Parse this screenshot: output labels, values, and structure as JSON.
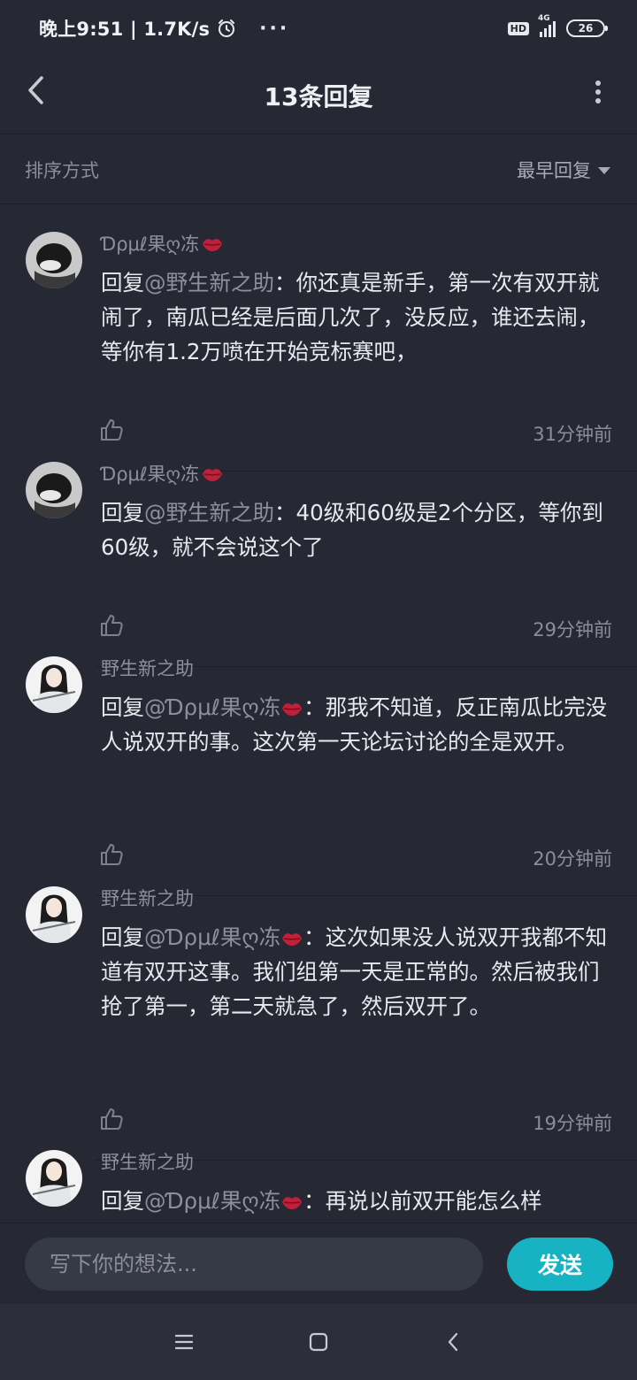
{
  "status_bar": {
    "time_speed": "晚上9:51 | 1.7K/s",
    "more_dots": "···",
    "hd_badge": "HD",
    "network": "4G",
    "battery": "26"
  },
  "nav": {
    "title": "13条回复"
  },
  "sort": {
    "label": "排序方式",
    "value": "最早回复"
  },
  "comments": [
    {
      "user": "Ɗρμℓ果ღ冻",
      "reply_prefix": "回复",
      "mention": "@野生新之助",
      "mention_has_lips": false,
      "text": "：你还真是新手，第一次有双开就闹了，南瓜已经是后面几次了，没反应，谁还去闹，等你有1.2万喷在开始竞标赛吧，",
      "time": "31分钟前",
      "user_has_lips": true,
      "avatar": "dark-avatar"
    },
    {
      "user": "Ɗρμℓ果ღ冻",
      "reply_prefix": "回复",
      "mention": "@野生新之助",
      "mention_has_lips": false,
      "text": "：40级和60级是2个分区，等你到60级，就不会说这个了",
      "time": "29分钟前",
      "user_has_lips": true,
      "avatar": "dark-avatar"
    },
    {
      "user": "野生新之助",
      "reply_prefix": "回复",
      "mention": "@Ɗρμℓ果ღ冻",
      "mention_has_lips": true,
      "text": "：那我不知道，反正南瓜比完没人说双开的事。这次第一天论坛讨论的全是双开。",
      "time": "20分钟前",
      "user_has_lips": false,
      "avatar": "white-avatar"
    },
    {
      "user": "野生新之助",
      "reply_prefix": "回复",
      "mention": "@Ɗρμℓ果ღ冻",
      "mention_has_lips": true,
      "text": "：这次如果没人说双开我都不知道有双开这事。我们组第一天是正常的。然后被我们抢了第一，第二天就急了，然后双开了。",
      "time": "19分钟前",
      "user_has_lips": false,
      "avatar": "white-avatar"
    },
    {
      "user": "野生新之助",
      "reply_prefix": "回复",
      "mention": "@Ɗρμℓ果ღ冻",
      "mention_has_lips": true,
      "text": "：再说以前双开能怎么样",
      "time": "",
      "user_has_lips": false,
      "avatar": "white-avatar"
    }
  ],
  "input": {
    "placeholder": "写下你的想法...",
    "send_label": "发送"
  },
  "icons": {
    "back": "back-arrow-icon",
    "more": "more-vertical-icon",
    "like": "thumbs-up-icon",
    "alarm": "alarm-clock-icon",
    "lips": "kiss-lips-icon",
    "menu": "menu-icon",
    "home": "home-square-icon",
    "sys_back": "sys-back-icon"
  },
  "colors": {
    "background": "#262833",
    "accent": "#18b3c2",
    "muted_text": "#8d909b",
    "body_text": "#e8e9ee"
  }
}
